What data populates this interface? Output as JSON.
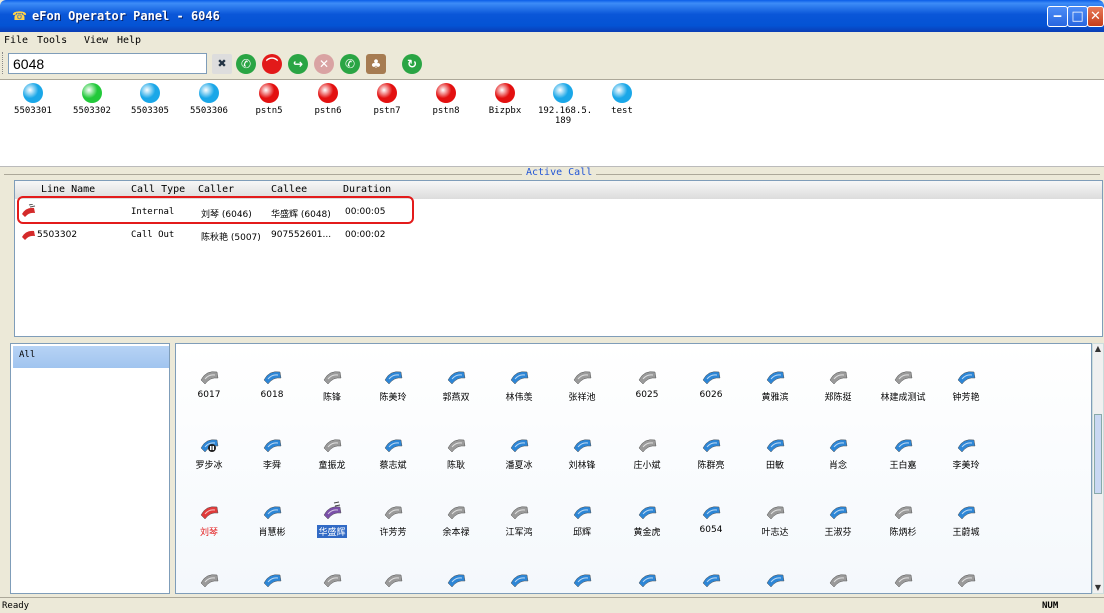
{
  "window": {
    "title": "eFon Operator Panel - 6046"
  },
  "menu": [
    "File",
    "Tools",
    "View",
    "Help"
  ],
  "toolbar": {
    "search_value": "6048"
  },
  "extensions": [
    {
      "label": "5503301",
      "status": "#1aa7e8"
    },
    {
      "label": "5503302",
      "status": "#22c93a"
    },
    {
      "label": "5503305",
      "status": "#1aa7e8"
    },
    {
      "label": "5503306",
      "status": "#1aa7e8"
    },
    {
      "label": "pstn5",
      "status": "#e31010"
    },
    {
      "label": "pstn6",
      "status": "#e31010"
    },
    {
      "label": "pstn7",
      "status": "#e31010"
    },
    {
      "label": "pstn8",
      "status": "#e31010"
    },
    {
      "label": "Bizpbx",
      "status": "#e31010"
    },
    {
      "label": "192.168.5.\n189",
      "status": "#1aa7e8"
    },
    {
      "label": "test",
      "status": "#1aa7e8"
    }
  ],
  "active_call": {
    "title": "Active Call",
    "columns": [
      "Line Name",
      "Call Type",
      "Caller",
      "Callee",
      "Duration"
    ],
    "rows": [
      {
        "line": "",
        "type": "Internal",
        "caller": "刘琴 (6046)",
        "callee": "华盛辉 (6048)",
        "duration": "00:00:05"
      },
      {
        "line": "5503302",
        "type": "Call Out",
        "caller": "陈秋艳 (5007)",
        "callee": "907552601...",
        "duration": "00:00:02"
      }
    ]
  },
  "groups": [
    "All"
  ],
  "contacts": [
    [
      {
        "n": "6017",
        "s": "gray"
      },
      {
        "n": "6018",
        "s": "blue"
      },
      {
        "n": "陈锋",
        "s": "gray"
      },
      {
        "n": "陈美玲",
        "s": "blue"
      },
      {
        "n": "郭燕双",
        "s": "blue"
      },
      {
        "n": "林伟羡",
        "s": "blue"
      },
      {
        "n": "张祥池",
        "s": "gray"
      },
      {
        "n": "6025",
        "s": "gray"
      },
      {
        "n": "6026",
        "s": "blue"
      },
      {
        "n": "黄雅滨",
        "s": "blue"
      },
      {
        "n": "郑陈挺",
        "s": "gray"
      },
      {
        "n": "林建成测试",
        "s": "gray"
      },
      {
        "n": "钟芳艳",
        "s": "blue"
      }
    ],
    [
      {
        "n": "罗步冰",
        "s": "busy"
      },
      {
        "n": "李舜",
        "s": "blue"
      },
      {
        "n": "童振龙",
        "s": "gray"
      },
      {
        "n": "蔡志斌",
        "s": "blue"
      },
      {
        "n": "陈耿",
        "s": "gray"
      },
      {
        "n": "潘夏冰",
        "s": "blue"
      },
      {
        "n": "刘林锋",
        "s": "blue"
      },
      {
        "n": "庄小斌",
        "s": "gray"
      },
      {
        "n": "陈群亮",
        "s": "blue"
      },
      {
        "n": "田敏",
        "s": "blue"
      },
      {
        "n": "肖念",
        "s": "blue"
      },
      {
        "n": "王白嘉",
        "s": "blue"
      },
      {
        "n": "李美玲",
        "s": "blue"
      }
    ],
    [
      {
        "n": "刘琴",
        "s": "red"
      },
      {
        "n": "肖慧彬",
        "s": "blue"
      },
      {
        "n": "华盛辉",
        "s": "ring"
      },
      {
        "n": "许芳芳",
        "s": "gray"
      },
      {
        "n": "余本禄",
        "s": "gray"
      },
      {
        "n": "江军鸿",
        "s": "gray"
      },
      {
        "n": "邱辉",
        "s": "blue"
      },
      {
        "n": "黄金虎",
        "s": "blue"
      },
      {
        "n": "6054",
        "s": "blue"
      },
      {
        "n": "叶志达",
        "s": "gray"
      },
      {
        "n": "王淑芬",
        "s": "blue"
      },
      {
        "n": "陈炳杉",
        "s": "gray"
      },
      {
        "n": "王蔚城",
        "s": "blue"
      }
    ],
    [
      {
        "n": "",
        "s": "gray"
      },
      {
        "n": "",
        "s": "blue"
      },
      {
        "n": "",
        "s": "gray"
      },
      {
        "n": "",
        "s": "gray"
      },
      {
        "n": "",
        "s": "blue"
      },
      {
        "n": "",
        "s": "blue"
      },
      {
        "n": "",
        "s": "blue"
      },
      {
        "n": "",
        "s": "blue"
      },
      {
        "n": "",
        "s": "blue"
      },
      {
        "n": "",
        "s": "blue"
      },
      {
        "n": "",
        "s": "gray"
      },
      {
        "n": "",
        "s": "gray"
      },
      {
        "n": "",
        "s": "gray"
      }
    ]
  ],
  "status": {
    "left": "Ready",
    "right": "NUM"
  }
}
